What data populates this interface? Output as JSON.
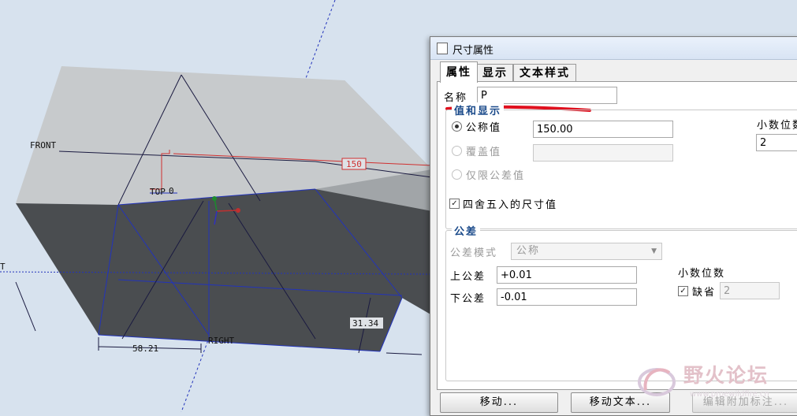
{
  "viewport": {
    "labels": {
      "front": "FRONT",
      "right": "RIGHT",
      "top": "TOP",
      "left_partial": "T",
      "origin": "0"
    },
    "dimensions": {
      "d1": "150",
      "d2": "58.21",
      "d3": "31.34"
    },
    "colors": {
      "background": "#d7e2ee",
      "box_top": "#c7cacc",
      "box_side": "#a1a5a8",
      "box_front": "#4a4d50",
      "datum": "#2233bb",
      "dimension": "#d03030"
    }
  },
  "dialog": {
    "title": "尺寸属性",
    "tabs": [
      {
        "label": "属性",
        "active": true
      },
      {
        "label": "显示",
        "active": false
      },
      {
        "label": "文本样式",
        "active": false
      }
    ],
    "name_label": "名称",
    "name_value": "P",
    "value_group": {
      "legend": "值和显示",
      "nominal_label": "公称值",
      "nominal_value": "150.00",
      "override_label": "覆盖值",
      "override_value": "",
      "tolerance_only_label": "仅限公差值",
      "decimals_label": "小数位数",
      "decimals_value": "2",
      "rounded_label": "四舍五入的尺寸值"
    },
    "tolerance_group": {
      "legend": "公差",
      "mode_label": "公差模式",
      "mode_value": "公称",
      "upper_label": "上公差",
      "upper_value": "+0.01",
      "lower_label": "下公差",
      "lower_value": "-0.01",
      "decimals_label": "小数位数",
      "default_label": "缺省",
      "decimals_value": "2"
    },
    "buttons": {
      "move": "移动...",
      "move_text": "移动文本...",
      "edit_attached": "编辑附加标注..."
    }
  },
  "watermark": {
    "text": "野火论坛",
    "url": "www.proewildfire.cn"
  },
  "accent_underline_color": "#e0101e"
}
